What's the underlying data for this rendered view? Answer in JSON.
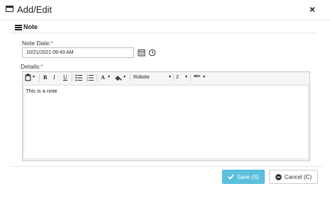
{
  "dialog": {
    "title": "Add/Edit",
    "close_label": "×"
  },
  "section": {
    "title": "Note"
  },
  "note_date": {
    "label": "Note Date:",
    "required_mark": "*",
    "value": "10/21/2021 09:43 AM"
  },
  "details": {
    "label": "Details:",
    "required_mark": "*",
    "content": "This is a note"
  },
  "toolbar": {
    "bold": "B",
    "italic": "I",
    "underline": "U",
    "font_color": "A",
    "font_name": "Roboto",
    "font_size": "2",
    "spellcheck": "abc",
    "dropdown_arrow": "▾"
  },
  "footer": {
    "save_label": "Save (S)",
    "cancel_label": "Cancel (C)"
  },
  "colors": {
    "save_bg": "#5bc0de",
    "required": "#d9534f"
  }
}
